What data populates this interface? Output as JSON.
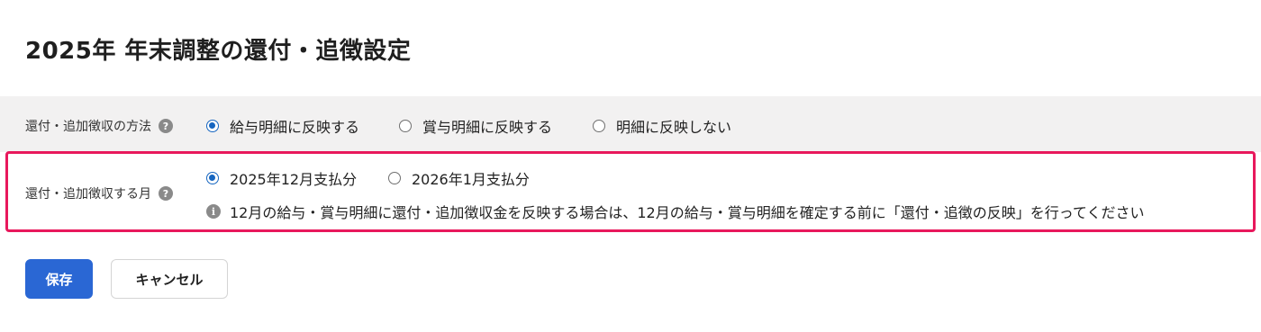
{
  "page": {
    "title": "2025年 年末調整の還付・追徴設定"
  },
  "method": {
    "label": "還付・追加徴収の方法",
    "help_icon": "?",
    "options": [
      {
        "label": "給与明細に反映する",
        "checked": true
      },
      {
        "label": "賞与明細に反映する",
        "checked": false
      },
      {
        "label": "明細に反映しない",
        "checked": false
      }
    ]
  },
  "month": {
    "label": "還付・追加徴収する月",
    "help_icon": "?",
    "options": [
      {
        "label": "2025年12月支払分",
        "checked": true
      },
      {
        "label": "2026年1月支払分",
        "checked": false
      }
    ],
    "info_icon": "i",
    "info_text": "12月の給与・賞与明細に還付・追加徴収金を反映する場合は、12月の給与・賞与明細を確定する前に「還付・追徴の反映」を行ってください"
  },
  "buttons": {
    "save_label": "保存",
    "cancel_label": "キャンセル"
  },
  "colors": {
    "primary": "#2a67d4",
    "highlight_border": "#e8185c",
    "radio_checked": "#1565c0",
    "row_background": "#f2f1f1"
  }
}
